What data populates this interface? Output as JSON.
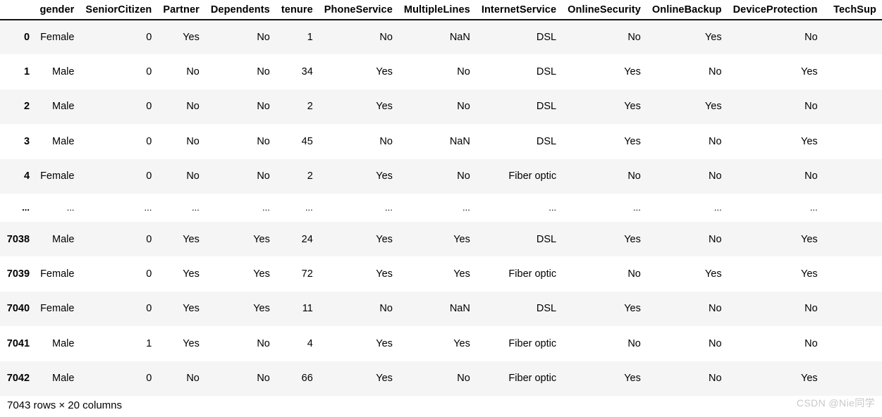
{
  "table": {
    "index_header": "",
    "columns": [
      "gender",
      "SeniorCitizen",
      "Partner",
      "Dependents",
      "tenure",
      "PhoneService",
      "MultipleLines",
      "InternetService",
      "OnlineSecurity",
      "OnlineBackup",
      "DeviceProtection",
      "TechSupport"
    ],
    "columns_visible_text": [
      "gender",
      "SeniorCitizen",
      "Partner",
      "Dependents",
      "tenure",
      "PhoneService",
      "MultipleLines",
      "InternetService",
      "OnlineSecurity",
      "OnlineBackup",
      "DeviceProtection",
      "TechSup"
    ],
    "ellipsis": "...",
    "rows": [
      {
        "index": "0",
        "cells": [
          "Female",
          "0",
          "Yes",
          "No",
          "1",
          "No",
          "NaN",
          "DSL",
          "No",
          "Yes",
          "No",
          ""
        ]
      },
      {
        "index": "1",
        "cells": [
          "Male",
          "0",
          "No",
          "No",
          "34",
          "Yes",
          "No",
          "DSL",
          "Yes",
          "No",
          "Yes",
          ""
        ]
      },
      {
        "index": "2",
        "cells": [
          "Male",
          "0",
          "No",
          "No",
          "2",
          "Yes",
          "No",
          "DSL",
          "Yes",
          "Yes",
          "No",
          ""
        ]
      },
      {
        "index": "3",
        "cells": [
          "Male",
          "0",
          "No",
          "No",
          "45",
          "No",
          "NaN",
          "DSL",
          "Yes",
          "No",
          "Yes",
          ""
        ]
      },
      {
        "index": "4",
        "cells": [
          "Female",
          "0",
          "No",
          "No",
          "2",
          "Yes",
          "No",
          "Fiber optic",
          "No",
          "No",
          "No",
          ""
        ]
      },
      {
        "index": "...",
        "cells": [
          "...",
          "...",
          "...",
          "...",
          "...",
          "...",
          "...",
          "...",
          "...",
          "...",
          "...",
          ""
        ]
      },
      {
        "index": "7038",
        "cells": [
          "Male",
          "0",
          "Yes",
          "Yes",
          "24",
          "Yes",
          "Yes",
          "DSL",
          "Yes",
          "No",
          "Yes",
          ""
        ]
      },
      {
        "index": "7039",
        "cells": [
          "Female",
          "0",
          "Yes",
          "Yes",
          "72",
          "Yes",
          "Yes",
          "Fiber optic",
          "No",
          "Yes",
          "Yes",
          ""
        ]
      },
      {
        "index": "7040",
        "cells": [
          "Female",
          "0",
          "Yes",
          "Yes",
          "11",
          "No",
          "NaN",
          "DSL",
          "Yes",
          "No",
          "No",
          ""
        ]
      },
      {
        "index": "7041",
        "cells": [
          "Male",
          "1",
          "Yes",
          "No",
          "4",
          "Yes",
          "Yes",
          "Fiber optic",
          "No",
          "No",
          "No",
          ""
        ]
      },
      {
        "index": "7042",
        "cells": [
          "Male",
          "0",
          "No",
          "No",
          "66",
          "Yes",
          "No",
          "Fiber optic",
          "Yes",
          "No",
          "Yes",
          ""
        ]
      }
    ]
  },
  "footer": {
    "shape_text": "7043 rows × 20 columns"
  },
  "watermark": {
    "text": "CSDN @Nie同学"
  },
  "colors": {
    "stripe": "#f5f5f5",
    "background": "#ffffff",
    "text": "#000000",
    "header_rule": "#111111",
    "watermark": "#c9c9c9"
  }
}
